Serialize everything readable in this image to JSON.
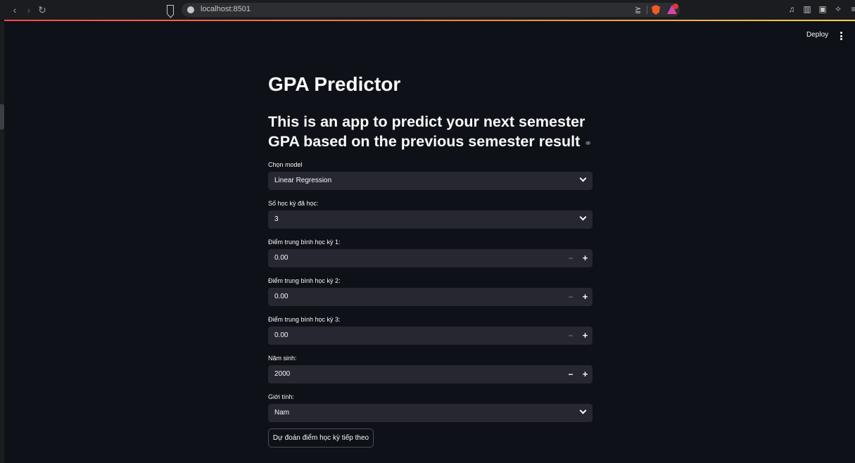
{
  "browser": {
    "url": "localhost:8501"
  },
  "header": {
    "deploy_label": "Deploy"
  },
  "app": {
    "title": "GPA Predictor",
    "subtitle": "This is an app to predict your next semester GPA based on the previous semester result",
    "link_icon": "⚭"
  },
  "fields": {
    "model": {
      "label": "Chọn model",
      "value": "Linear Regression"
    },
    "semesters": {
      "label": "Số học kỳ đã học:",
      "value": "3"
    },
    "gpa1": {
      "label": "Điểm trung bình học kỳ 1:",
      "value": "0.00"
    },
    "gpa2": {
      "label": "Điểm trung bình học kỳ 2:",
      "value": "0.00"
    },
    "gpa3": {
      "label": "Điểm trung bình học kỳ 3:",
      "value": "0.00"
    },
    "birth_year": {
      "label": "Năm sinh:",
      "value": "2000"
    },
    "gender": {
      "label": "Giới tính:",
      "value": "Nam"
    }
  },
  "controls": {
    "minus": "−",
    "plus": "+"
  },
  "predict_button": "Dự đoán điểm học kỳ tiếp theo",
  "colors": {
    "background": "#0e1117",
    "input_bg": "#262730",
    "accent": "#ff4b4b"
  }
}
